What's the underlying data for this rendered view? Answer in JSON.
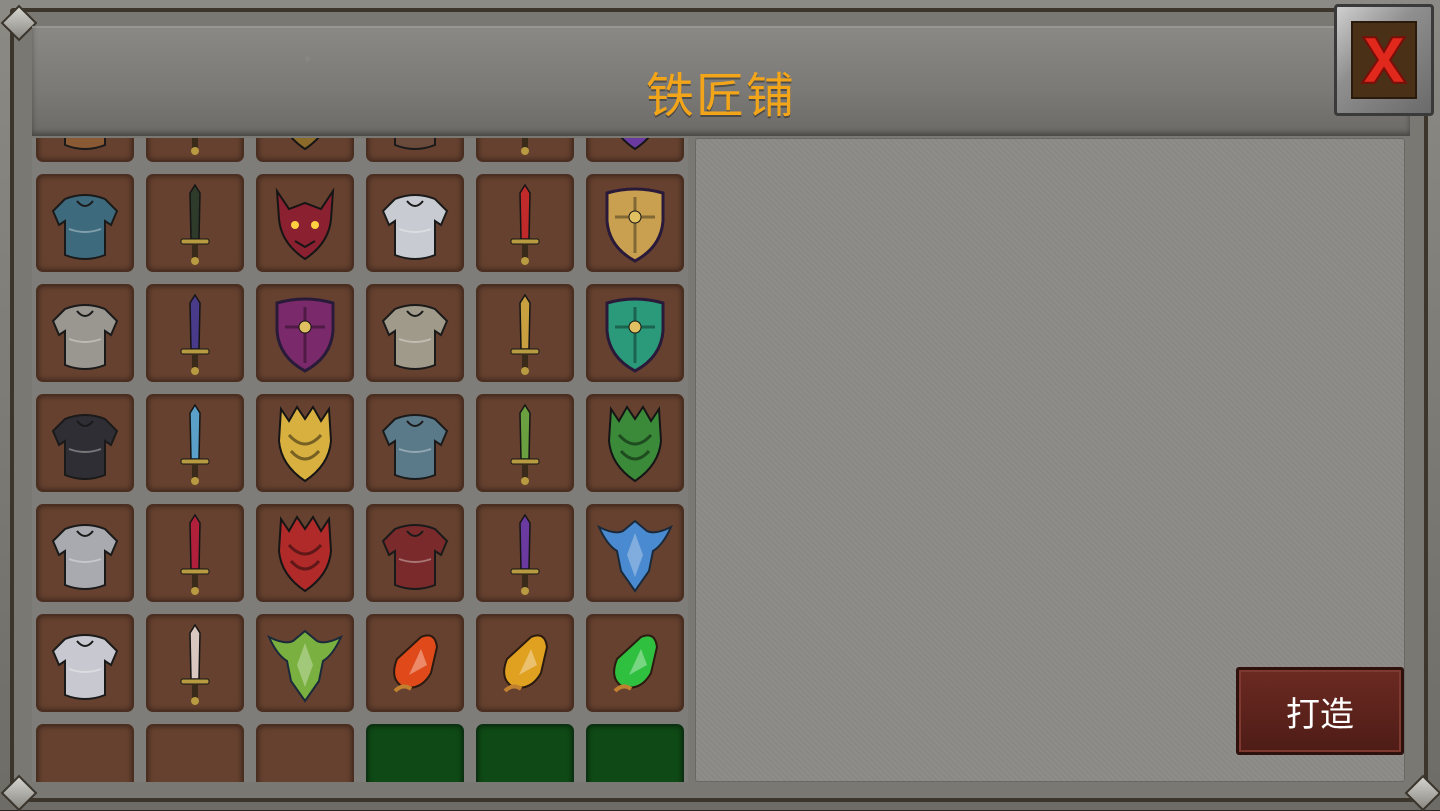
{
  "title": "铁匠铺",
  "forge_button": "打造",
  "close_icon": "close-x-icon",
  "colors": {
    "title": "#f3a51a",
    "slot_bg": "#66412f",
    "slot_green": "#0f4a16",
    "forge_button_bg": "#5a221b",
    "close_x": "#e0291c"
  },
  "items": [
    {
      "type": "body-armor",
      "color": "#8a5a34"
    },
    {
      "type": "sword",
      "color": "#9ab340"
    },
    {
      "type": "demon-helm",
      "color": "#8b6a2a"
    },
    {
      "type": "body-armor",
      "color": "#6a4a3a"
    },
    {
      "type": "sword",
      "color": "#b8a060"
    },
    {
      "type": "demon-helm",
      "color": "#6a3aa0"
    },
    {
      "type": "body-armor",
      "color": "#3e6a7e"
    },
    {
      "type": "sword",
      "color": "#2e3a2a"
    },
    {
      "type": "demon-helm",
      "color": "#8a2030"
    },
    {
      "type": "body-armor",
      "color": "#c8ccd2"
    },
    {
      "type": "sword",
      "color": "#c02a2a"
    },
    {
      "type": "shield",
      "color": "#c8a050"
    },
    {
      "type": "body-armor",
      "color": "#9a9690"
    },
    {
      "type": "sword",
      "color": "#4a3a8a"
    },
    {
      "type": "shield",
      "color": "#7a2a6a"
    },
    {
      "type": "body-armor",
      "color": "#a09a8a"
    },
    {
      "type": "sword",
      "color": "#c8a040"
    },
    {
      "type": "shield",
      "color": "#2a9a7a"
    },
    {
      "type": "body-armor",
      "color": "#2e2e34"
    },
    {
      "type": "sword",
      "color": "#5aa0c8"
    },
    {
      "type": "spiked-shield",
      "color": "#d8b040"
    },
    {
      "type": "body-armor",
      "color": "#5a7a8a"
    },
    {
      "type": "sword",
      "color": "#6aa040"
    },
    {
      "type": "spiked-shield",
      "color": "#3a8a3a"
    },
    {
      "type": "body-armor",
      "color": "#a8aab0"
    },
    {
      "type": "sword",
      "color": "#b0203a"
    },
    {
      "type": "spiked-shield",
      "color": "#b02a2a"
    },
    {
      "type": "body-armor",
      "color": "#7a2a2a"
    },
    {
      "type": "sword",
      "color": "#6a3aa0"
    },
    {
      "type": "winged-shield",
      "color": "#4a8ad0"
    },
    {
      "type": "body-armor",
      "color": "#c8c8d0"
    },
    {
      "type": "sword",
      "color": "#d8c8c0"
    },
    {
      "type": "winged-shield",
      "color": "#7ab040"
    },
    {
      "type": "gem",
      "color": "#e04a1a"
    },
    {
      "type": "gem",
      "color": "#e0a020"
    },
    {
      "type": "gem",
      "color": "#30c040"
    },
    {
      "type": "empty",
      "color": ""
    },
    {
      "type": "empty",
      "color": ""
    },
    {
      "type": "empty",
      "color": ""
    },
    {
      "type": "green-empty",
      "color": ""
    },
    {
      "type": "green-empty",
      "color": ""
    },
    {
      "type": "green-empty",
      "color": ""
    }
  ]
}
